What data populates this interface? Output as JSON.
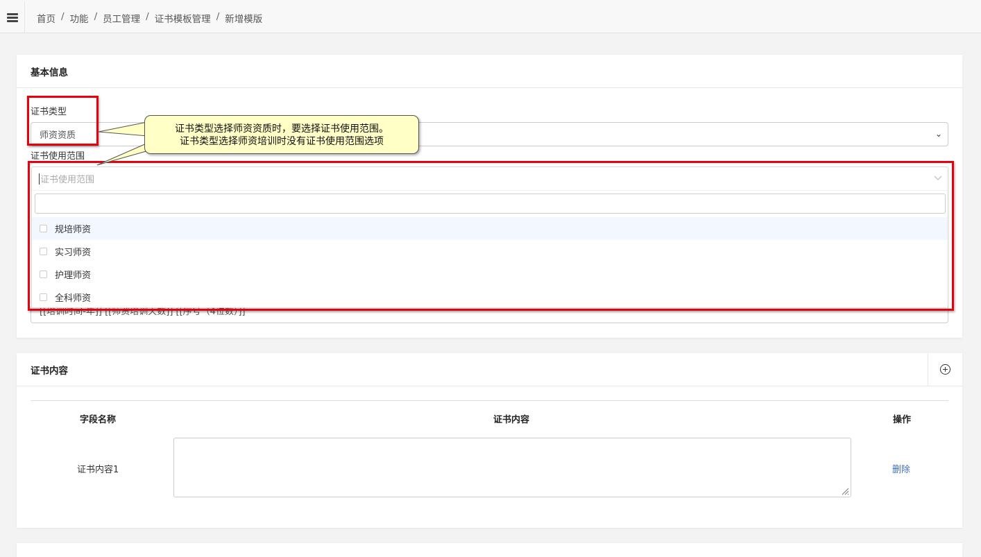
{
  "breadcrumb": [
    "首页",
    "功能",
    "员工管理",
    "证书模板管理",
    "新增模版"
  ],
  "breadcrumb_sep": "/",
  "basic": {
    "title": "基本信息",
    "cert_type_label": "证书类型",
    "cert_type_value": "师资资质",
    "cert_scope_label": "证书使用范围",
    "cert_scope_placeholder": "证书使用范围",
    "scope_options": [
      "规培师资",
      "实习师资",
      "护理师资",
      "全科师资"
    ],
    "number_rule_partial": "[[培训时间-年]] [[师资培训天数]] [[序号（4位数）]]"
  },
  "callout": {
    "line1": "证书类型选择师资资质时，要选择证书使用范围。",
    "line2": "证书类型选择师资培训时没有证书使用范围选项"
  },
  "content": {
    "title": "证书内容",
    "col_field": "字段名称",
    "col_content": "证书内容",
    "col_action": "操作",
    "rows": [
      {
        "field": "证书内容1",
        "action": "删除"
      }
    ]
  },
  "colors": {
    "annotation_red": "#e8000b",
    "callout_bg": "#ffffc6",
    "link": "#3c6fc7"
  }
}
